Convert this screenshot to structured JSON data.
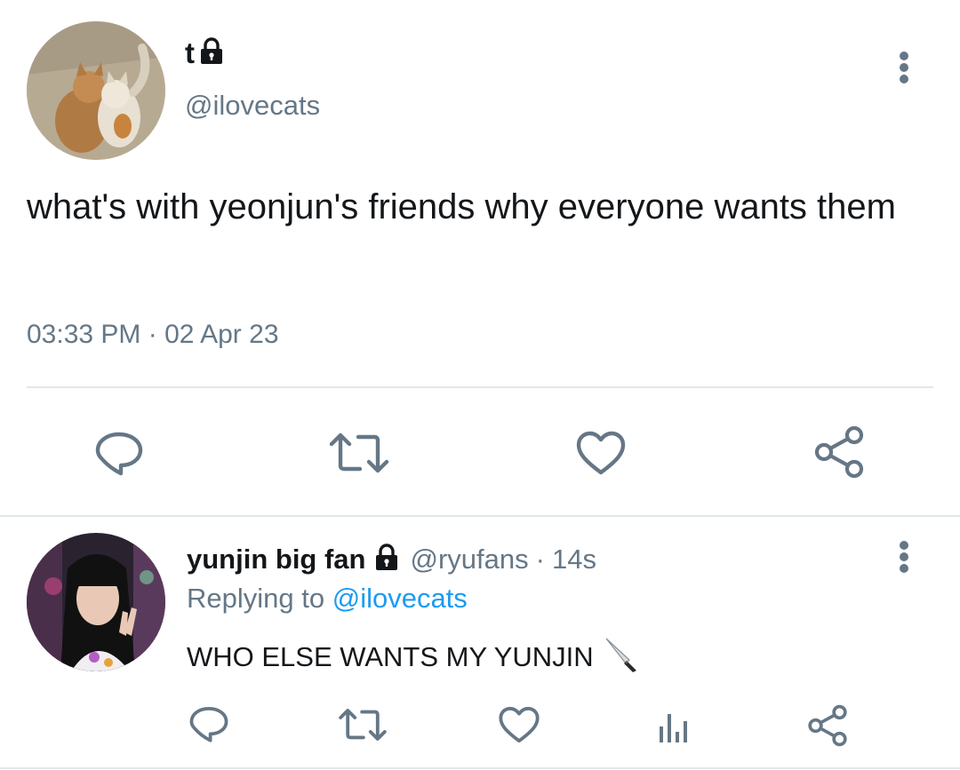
{
  "main_tweet": {
    "display_name": "t",
    "handle": "@ilovecats",
    "text": "what's with yeonjun's friends why everyone wants them",
    "timestamp": "03:33 PM · 02 Apr 23",
    "locked": true,
    "actions": [
      "reply-icon",
      "retweet-icon",
      "like-icon",
      "share-icon"
    ]
  },
  "reply_tweet": {
    "display_name": "yunjin big fan",
    "handle": "@ryufans",
    "separator": "·",
    "age": "14s",
    "replying_to_label": "Replying to",
    "replying_to_handle": "@ilovecats",
    "text": "WHO ELSE WANTS MY YUNJIN",
    "emoji": "🔪",
    "locked": true,
    "actions": [
      "reply-icon",
      "retweet-icon",
      "like-icon",
      "analytics-icon",
      "share-icon"
    ]
  },
  "colors": {
    "text": "#14171a",
    "secondary": "#657786",
    "accent": "#1d9bf0",
    "divider": "#e1e8ed"
  }
}
